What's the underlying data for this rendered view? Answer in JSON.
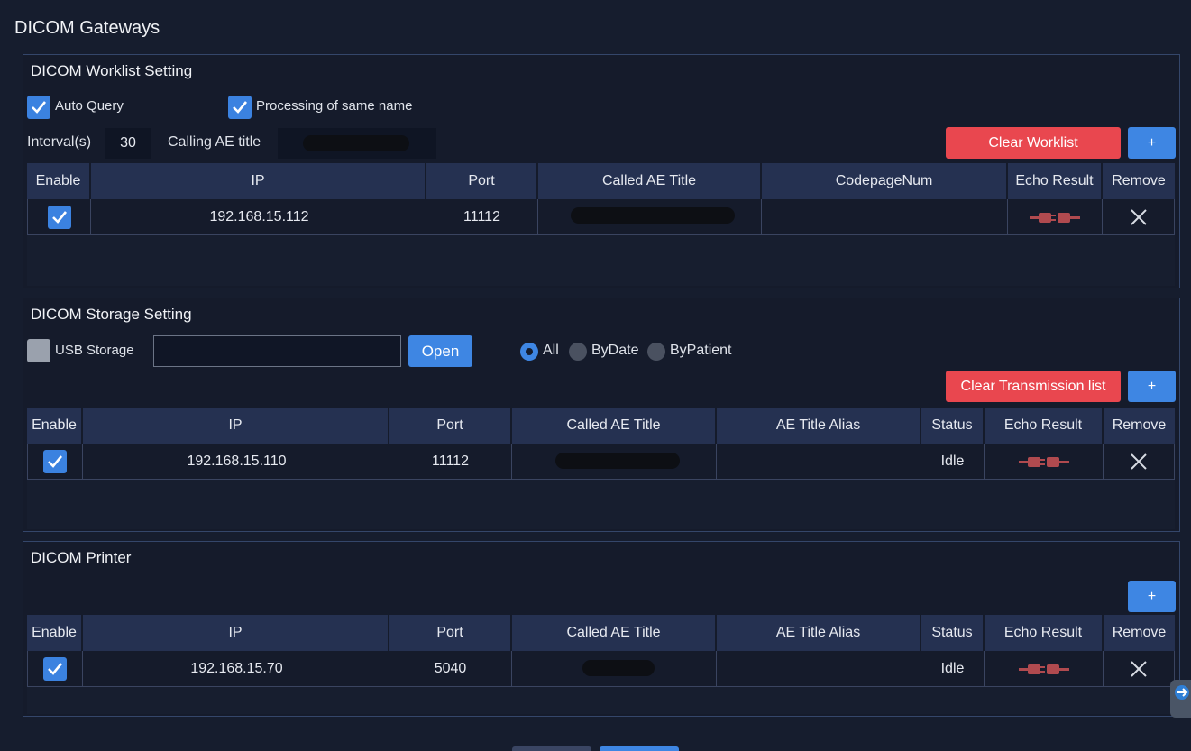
{
  "page_title": "DICOM Gateways",
  "icons": {
    "check": "check-icon",
    "echo": "plug-disconnected-icon",
    "remove": "close-icon"
  },
  "colors": {
    "accent": "#3e86e3",
    "danger": "#e9474f",
    "echo_fail": "#b04a4f"
  },
  "worklist": {
    "title": "DICOM Worklist Setting",
    "auto_query_label": "Auto Query",
    "auto_query": true,
    "same_name_label": "Processing of same name",
    "same_name": true,
    "interval_label": "Interval(s)",
    "interval_value": "30",
    "calling_ae_label": "Calling AE title",
    "clear_label": "Clear Worklist",
    "add_label": "+",
    "columns": [
      "Enable",
      "IP",
      "Port",
      "Called AE Title",
      "CodepageNum",
      "Echo Result",
      "Remove"
    ],
    "rows": [
      {
        "enabled": true,
        "ip": [
          "192",
          "168",
          "15",
          "112"
        ],
        "port": "11112",
        "codepage": ""
      }
    ]
  },
  "storage": {
    "title": "DICOM Storage Setting",
    "usb_label": "USB Storage",
    "usb_enabled": false,
    "path_value": "",
    "open_label": "Open",
    "radios": [
      {
        "label": "All",
        "selected": true
      },
      {
        "label": "ByDate",
        "selected": false
      },
      {
        "label": "ByPatient",
        "selected": false
      }
    ],
    "clear_label": "Clear Transmission list",
    "add_label": "+",
    "columns": [
      "Enable",
      "IP",
      "Port",
      "Called AE Title",
      "AE Title Alias",
      "Status",
      "Echo Result",
      "Remove"
    ],
    "rows": [
      {
        "enabled": true,
        "ip": [
          "192",
          "168",
          "15",
          "110"
        ],
        "port": "11112",
        "alias": "",
        "status": "Idle"
      }
    ]
  },
  "printer": {
    "title": "DICOM Printer",
    "add_label": "+",
    "columns": [
      "Enable",
      "IP",
      "Port",
      "Called AE Title",
      "AE Title Alias",
      "Status",
      "Echo Result",
      "Remove"
    ],
    "rows": [
      {
        "enabled": true,
        "ip": [
          "192",
          "168",
          "15",
          "70"
        ],
        "port": "5040",
        "alias": "",
        "status": "Idle"
      }
    ]
  },
  "ip_dot": "."
}
